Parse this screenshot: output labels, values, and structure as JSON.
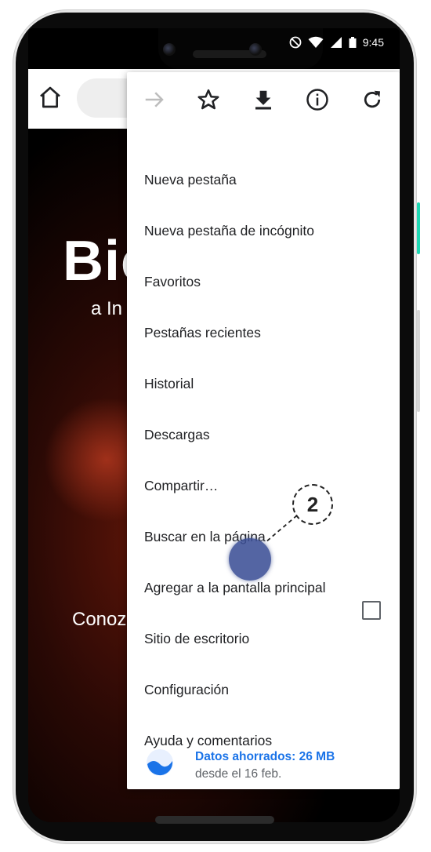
{
  "status_bar": {
    "time": "9:45"
  },
  "page": {
    "hero_title": "Bic",
    "hero_subtitle": "a In",
    "hero_cta": "Conoz"
  },
  "menu": {
    "items": [
      "Nueva pestaña",
      "Nueva pestaña de incógnito",
      "Favoritos",
      "Pestañas recientes",
      "Historial",
      "Descargas",
      "Compartir…",
      "Buscar en la página",
      "Agregar a la pantalla principal",
      "Sitio de escritorio",
      "Configuración",
      "Ayuda y comentarios"
    ],
    "desktop_site_checked": false,
    "savings": {
      "title": "Datos ahorrados: 26 MB",
      "subtitle": "desde el 16 feb."
    }
  },
  "tutorial": {
    "step_number": "2"
  },
  "icons": {
    "toolbar": [
      "home-icon"
    ],
    "menu_row": [
      "forward-icon",
      "star-icon",
      "download-icon",
      "info-icon",
      "refresh-icon"
    ]
  },
  "colors": {
    "accent_blue": "#1a73e8",
    "tap_indicator": "#3c5096",
    "side_button_accent": "#1ed8b3"
  }
}
